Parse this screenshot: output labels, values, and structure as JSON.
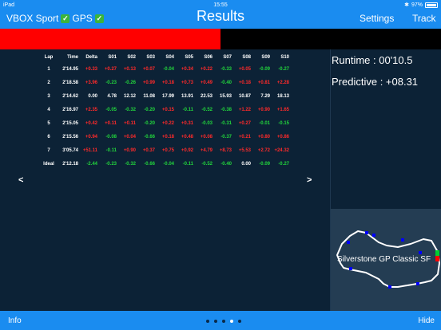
{
  "status_bar": {
    "device": "iPad",
    "time": "15:55",
    "battery": "97%"
  },
  "nav": {
    "vbox": "VBOX Sport",
    "gps": "GPS",
    "title": "Results",
    "settings": "Settings",
    "track": "Track"
  },
  "delta_bar": {
    "fill_fraction": 0.5,
    "color": "#ff0000"
  },
  "table": {
    "headers": [
      "Lap",
      "Time",
      "Delta",
      "S01",
      "S02",
      "S03",
      "S04",
      "S05",
      "S06",
      "S07",
      "S08",
      "S09",
      "S10"
    ],
    "rows": [
      [
        "1",
        "2'14.95",
        "+0.33",
        "+0.27",
        "+0.13",
        "+0.07",
        "-0.04",
        "+0.34",
        "+0.22",
        "-0.33",
        "+0.05",
        "-0.09",
        "-0.27"
      ],
      [
        "2",
        "2'18.58",
        "+3.96",
        "-0.23",
        "-0.26",
        "+0.99",
        "+0.18",
        "+0.73",
        "+0.49",
        "-0.40",
        "+0.18",
        "+0.81",
        "+2.28"
      ],
      [
        "3",
        "2'14.62",
        "0.00",
        "4.78",
        "12.12",
        "11.08",
        "17.99",
        "13.91",
        "22.53",
        "15.93",
        "10.87",
        "7.29",
        "18.13"
      ],
      [
        "4",
        "2'16.97",
        "+2.35",
        "-0.05",
        "-0.32",
        "-0.20",
        "+0.15",
        "-0.11",
        "-0.52",
        "-0.38",
        "+1.22",
        "+0.90",
        "+1.65"
      ],
      [
        "5",
        "2'15.05",
        "+0.42",
        "+0.11",
        "+0.11",
        "-0.20",
        "+0.22",
        "+0.31",
        "-0.03",
        "-0.31",
        "+0.27",
        "-0.01",
        "-0.15"
      ],
      [
        "6",
        "2'15.56",
        "+0.94",
        "-0.08",
        "+0.04",
        "-0.66",
        "+0.18",
        "+0.48",
        "+0.08",
        "-0.37",
        "+0.21",
        "+0.80",
        "+0.86"
      ],
      [
        "7",
        "3'05.74",
        "+51.11",
        "-0.11",
        "+0.90",
        "+0.37",
        "+0.75",
        "+0.92",
        "+4.79",
        "+8.73",
        "+5.53",
        "+2.72",
        "+24.32"
      ],
      [
        "Ideal",
        "2'12.18",
        "-2.44",
        "-0.23",
        "-0.32",
        "-0.66",
        "-0.04",
        "-0.11",
        "-0.52",
        "-0.40",
        "0.00",
        "-0.09",
        "-0.27"
      ]
    ]
  },
  "colors": {
    "positive": "#ff2a2a",
    "negative": "#22d43c",
    "neutral": "#ffffff",
    "accent": "#1a8cf0",
    "background": "#0c2236"
  },
  "pager": {
    "prev": "<",
    "next": ">"
  },
  "runtime": "Runtime : 00'10.5",
  "predictive": "Predictive : +08.31",
  "track_name": "Silverstone GP Classic SF",
  "footer": {
    "info": "Info",
    "help": "Hide"
  },
  "pages": {
    "count": 5,
    "active": 3
  }
}
